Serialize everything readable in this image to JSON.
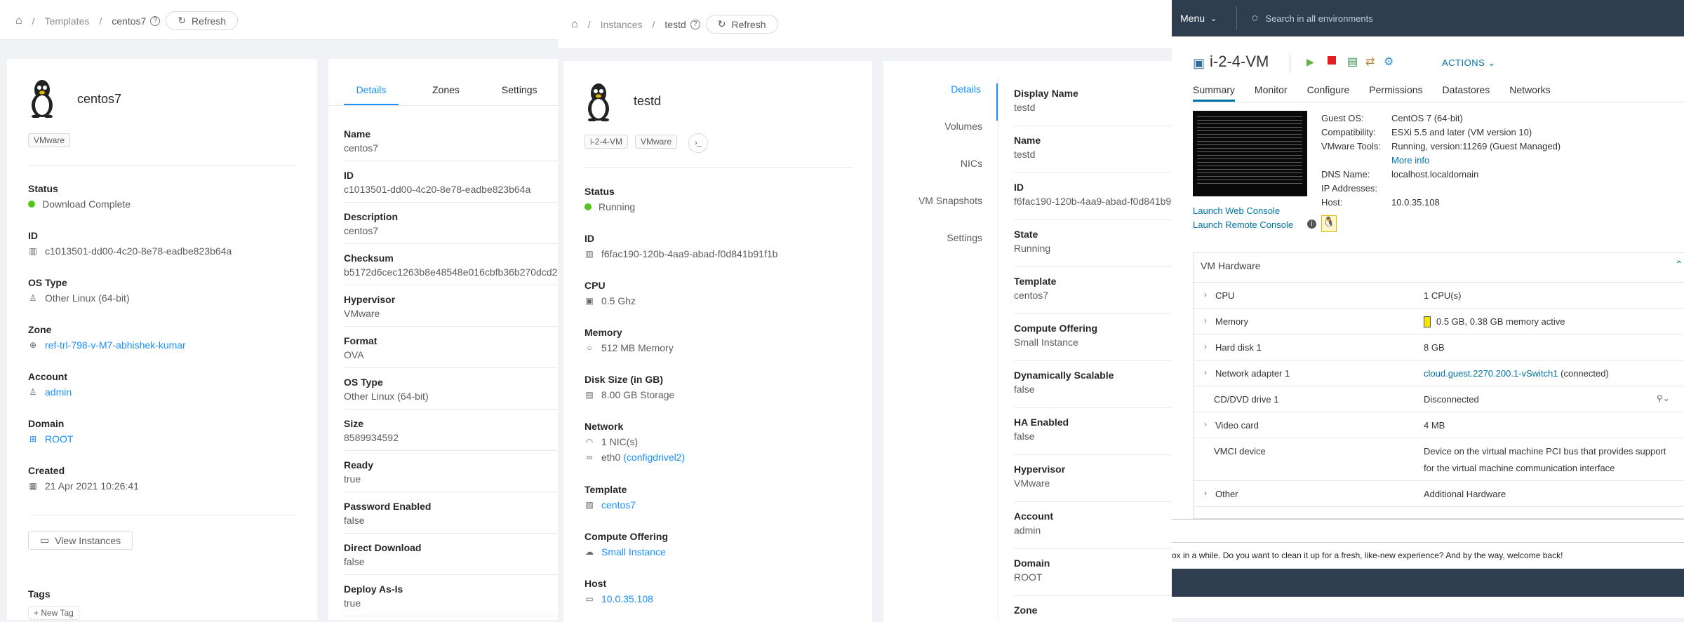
{
  "left": {
    "breadcrumb": {
      "home": "home-icon",
      "section": "Templates",
      "current": "centos7",
      "refresh": "Refresh"
    },
    "card": {
      "title": "centos7",
      "tag": "VMware",
      "fields": [
        {
          "label": "Status",
          "value": "Download Complete",
          "icon": "status-dot"
        },
        {
          "label": "ID",
          "value": "c1013501-dd00-4c20-8e78-eadbe823b64a",
          "icon": "barcode-icon"
        },
        {
          "label": "OS Type",
          "value": "Other Linux (64-bit)",
          "icon": "linux-icon"
        },
        {
          "label": "Zone",
          "value": "ref-trl-798-v-M7-abhishek-kumar",
          "icon": "globe-icon"
        },
        {
          "label": "Account",
          "value": "admin",
          "icon": "user-icon"
        },
        {
          "label": "Domain",
          "value": "ROOT",
          "icon": "domain-icon"
        },
        {
          "label": "Created",
          "value": "21 Apr 2021 10:26:41",
          "icon": "calendar-icon"
        }
      ],
      "view_instances": "View Instances",
      "tags_label": "Tags",
      "new_tag": "+ New Tag"
    },
    "tabs": [
      "Details",
      "Zones",
      "Settings"
    ],
    "details": [
      {
        "label": "Name",
        "value": "centos7"
      },
      {
        "label": "ID",
        "value": "c1013501-dd00-4c20-8e78-eadbe823b64a"
      },
      {
        "label": "Description",
        "value": "centos7"
      },
      {
        "label": "Checksum",
        "value": "b5172d6cec1263b8e48548e016cbfb36b270dcd2"
      },
      {
        "label": "Hypervisor",
        "value": "VMware"
      },
      {
        "label": "Format",
        "value": "OVA"
      },
      {
        "label": "OS Type",
        "value": "Other Linux (64-bit)"
      },
      {
        "label": "Size",
        "value": "8589934592"
      },
      {
        "label": "Ready",
        "value": "true"
      },
      {
        "label": "Password Enabled",
        "value": "false"
      },
      {
        "label": "Direct Download",
        "value": "false"
      },
      {
        "label": "Deploy As-Is",
        "value": "true"
      }
    ]
  },
  "middle": {
    "breadcrumb": {
      "section": "Instances",
      "current": "testd",
      "refresh": "Refresh"
    },
    "card": {
      "title": "testd",
      "tags": [
        "i-2-4-VM",
        "VMware"
      ],
      "fields": [
        {
          "label": "Status",
          "value": "Running"
        },
        {
          "label": "ID",
          "value": "f6fac190-120b-4aa9-abad-f0d841b91f1b"
        },
        {
          "label": "CPU",
          "value": "0.5 Ghz"
        },
        {
          "label": "Memory",
          "value": "512 MB Memory"
        },
        {
          "label": "Disk Size (in GB)",
          "value": "8.00 GB Storage"
        },
        {
          "label": "Network",
          "value": "1 NIC(s)",
          "value2_prefix": "eth0",
          "value2_link": "(configdrivel2)"
        },
        {
          "label": "Template",
          "value": "centos7"
        },
        {
          "label": "Compute Offering",
          "value": "Small Instance"
        },
        {
          "label": "Host",
          "value": "10.0.35.108"
        }
      ]
    },
    "vtabs": [
      "Details",
      "Volumes",
      "NICs",
      "VM Snapshots",
      "Settings"
    ],
    "details": [
      {
        "label": "Display Name",
        "value": "testd"
      },
      {
        "label": "Name",
        "value": "testd"
      },
      {
        "label": "ID",
        "value": "f6fac190-120b-4aa9-abad-f0d841b9"
      },
      {
        "label": "State",
        "value": "Running"
      },
      {
        "label": "Template",
        "value": "centos7"
      },
      {
        "label": "Compute Offering",
        "value": "Small Instance"
      },
      {
        "label": "Dynamically Scalable",
        "value": "false"
      },
      {
        "label": "HA Enabled",
        "value": "false"
      },
      {
        "label": "Hypervisor",
        "value": "VMware"
      },
      {
        "label": "Account",
        "value": "admin"
      },
      {
        "label": "Domain",
        "value": "ROOT"
      },
      {
        "label": "Zone",
        "value": ""
      }
    ]
  },
  "vsphere": {
    "menu": "Menu",
    "search_placeholder": "Search in all environments",
    "vm_name": "i-2-4-VM",
    "actions": "ACTIONS",
    "tabs": [
      "Summary",
      "Monitor",
      "Configure",
      "Permissions",
      "Datastores",
      "Networks"
    ],
    "info": [
      {
        "k": "Guest OS:",
        "v": "CentOS 7 (64-bit)"
      },
      {
        "k": "Compatibility:",
        "v": "ESXi 5.5 and later (VM version 10)"
      },
      {
        "k": "VMware Tools:",
        "v": "Running, version:11269 (Guest Managed)"
      },
      {
        "k": "",
        "v": "More info"
      },
      {
        "k": "DNS Name:",
        "v": "localhost.localdomain"
      },
      {
        "k": "IP Addresses:",
        "v": ""
      },
      {
        "k": "Host:",
        "v": "10.0.35.108"
      }
    ],
    "launch_web": "Launch Web Console",
    "launch_remote": "Launch Remote Console",
    "hw_title": "VM Hardware",
    "hw": [
      {
        "k": "CPU",
        "v": "1 CPU(s)"
      },
      {
        "k": "Memory",
        "v": "0.5 GB, 0.38 GB memory active"
      },
      {
        "k": "Hard disk 1",
        "v": "8 GB"
      },
      {
        "k": "Network adapter 1",
        "v_link": "cloud.guest.2270.200.1-vSwitch1",
        "v": "(connected)"
      },
      {
        "k": "CD/DVD drive 1",
        "v": "Disconnected"
      },
      {
        "k": "Video card",
        "v": "4 MB"
      },
      {
        "k": "VMCI device",
        "v": "Device on the virtual machine PCI bus that provides support",
        "v2": "for the virtual machine communication interface"
      },
      {
        "k": "Other",
        "v": "Additional Hardware"
      }
    ],
    "banner": "ox in a while. Do you want to clean it up for a fresh, like-new experience? And by the way, welcome back!"
  }
}
